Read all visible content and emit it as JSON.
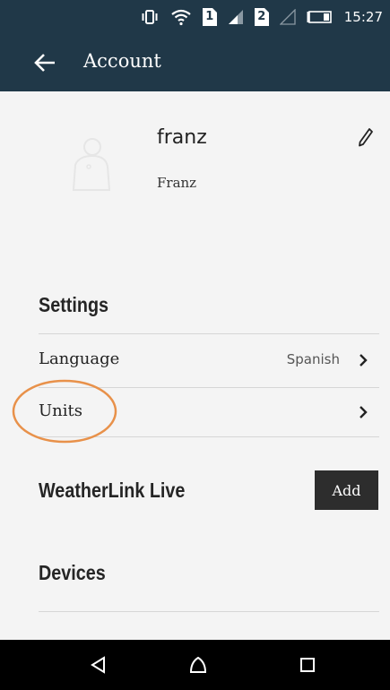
{
  "status_bar": {
    "time": "15:27",
    "sim1": "1",
    "sim2": "2"
  },
  "app_bar": {
    "title": "Account"
  },
  "profile": {
    "username": "franz",
    "display_name": "Franz"
  },
  "settings": {
    "title": "Settings",
    "language": {
      "label": "Language",
      "value": "Spanish"
    },
    "units": {
      "label": "Units"
    }
  },
  "weatherlink_live": {
    "title": "WeatherLink Live",
    "add_label": "Add"
  },
  "devices": {
    "title": "Devices"
  },
  "colors": {
    "header": "#203848",
    "highlight": "#e8914a",
    "add_button": "#2d2d2d",
    "nav_bar": "#000000"
  }
}
